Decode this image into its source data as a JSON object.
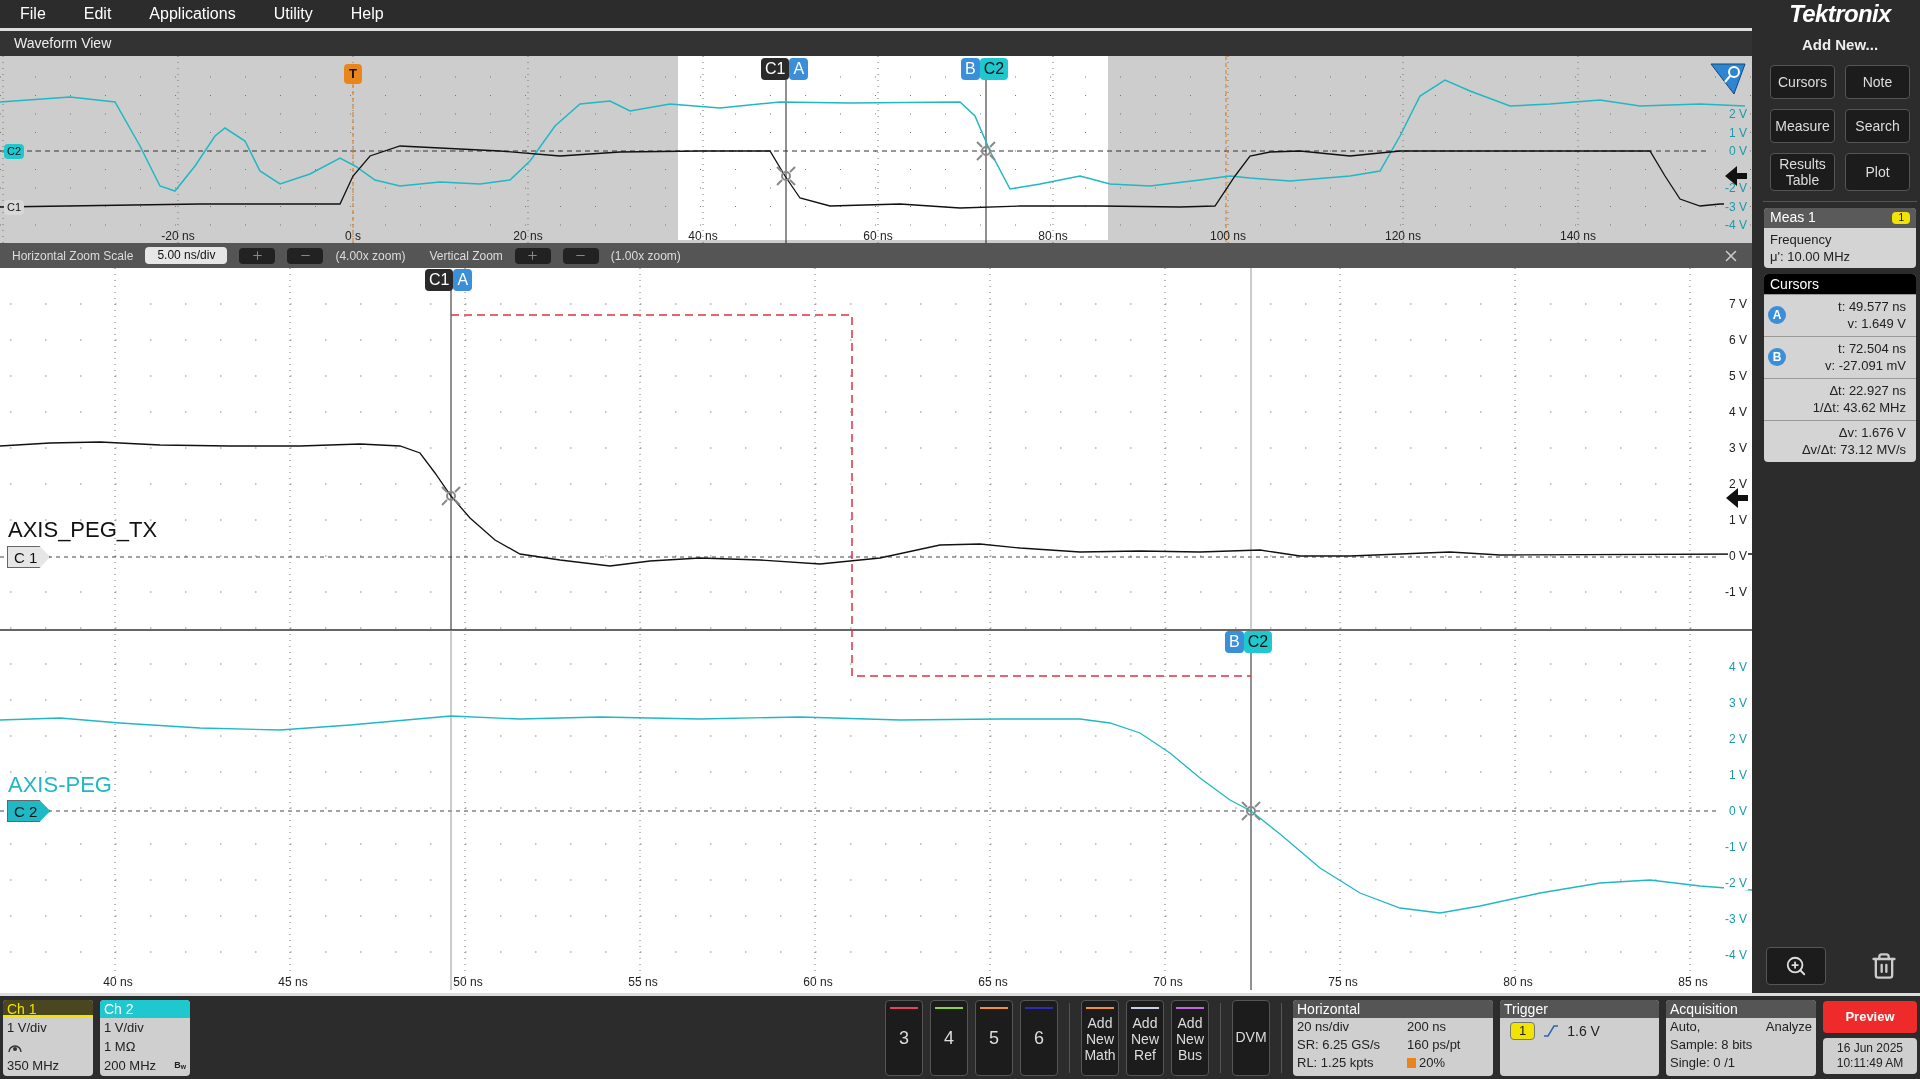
{
  "menu": [
    {
      "label": "File"
    },
    {
      "label": "Edit"
    },
    {
      "label": "Applications"
    },
    {
      "label": "Utility"
    },
    {
      "label": "Help"
    }
  ],
  "waveform_view": {
    "title": "Waveform View",
    "overview": {
      "x_ticks": [
        "-20 ns",
        "0 s",
        "20 ns",
        "40 ns",
        "60 ns",
        "80 ns",
        "100 ns",
        "120 ns",
        "140 ns"
      ],
      "y_ticks": [
        "2 V",
        "1 V",
        "0 V",
        "-2 V",
        "-3 V",
        "-4 V"
      ],
      "trigger_tag": "T",
      "channel_tags": [
        {
          "label": "C2",
          "color": "#1fc8cf"
        },
        {
          "label": "C1",
          "color": "#d8d8d8"
        }
      ],
      "cursor_a_tags": [
        "C1",
        "A"
      ],
      "cursor_b_tags": [
        "B",
        "C2"
      ]
    },
    "zoom_bar": {
      "horizontal_label": "Horizontal Zoom Scale",
      "horizontal_scale": "5.00 ns/div",
      "horizontal_zoom": "(4.00x zoom)",
      "vertical_label": "Vertical Zoom",
      "vertical_zoom": "(1.00x zoom)"
    },
    "main": {
      "x_ticks": [
        "40 ns",
        "45 ns",
        "50 ns",
        "55 ns",
        "60 ns",
        "65 ns",
        "70 ns",
        "75 ns",
        "80 ns",
        "85 ns"
      ],
      "upper_y_ticks": [
        "7 V",
        "6 V",
        "5 V",
        "4 V",
        "3 V",
        "2 V",
        "1 V",
        "0 V",
        "-1 V"
      ],
      "lower_y_ticks": [
        "4 V",
        "3 V",
        "2 V",
        "1 V",
        "0 V",
        "-1 V",
        "-2 V",
        "-3 V",
        "-4 V"
      ],
      "traces": [
        {
          "name": "AXIS_PEG_TX",
          "tag": "C 1",
          "color": "#111111"
        },
        {
          "name": "AXIS-PEG",
          "tag": "C 2",
          "color": "#1fb8c4"
        }
      ],
      "cursor_a_tags": [
        "C1",
        "A"
      ],
      "cursor_b_tags": [
        "B",
        "C2"
      ]
    }
  },
  "right_panel": {
    "logo": "Tektronix",
    "add_new": "Add New...",
    "buttons": [
      {
        "label": "Cursors"
      },
      {
        "label": "Note"
      },
      {
        "label": "Measure"
      },
      {
        "label": "Search"
      },
      {
        "label": "Results Table"
      },
      {
        "label": "Plot"
      }
    ],
    "measurement": {
      "title": "Meas 1",
      "source": "1",
      "name": "Frequency",
      "value": "μ': 10.00 MHz"
    },
    "cursors": {
      "title": "Cursors",
      "rows": [
        {
          "badge": "A",
          "lines": [
            "t: 49.577 ns",
            "v: 1.649 V"
          ]
        },
        {
          "badge": "B",
          "lines": [
            "t: 72.504 ns",
            "v: -27.091 mV"
          ]
        },
        {
          "lines": [
            "Δt: 22.927 ns",
            "1/Δt: 43.62 MHz"
          ]
        },
        {
          "lines": [
            "Δv: 1.676 V",
            "Δv/Δt: 73.12 MV/s"
          ]
        }
      ]
    }
  },
  "bottom_bar": {
    "channels": [
      {
        "label": "Ch 1",
        "selected": false,
        "color": "#f0e400",
        "lines": [
          {
            "kind": "text",
            "text": "1 V/div"
          },
          {
            "kind": "probe"
          },
          {
            "kind": "text",
            "text": "350 MHz"
          }
        ]
      },
      {
        "label": "Ch 2",
        "selected": true,
        "color": "#1fc8cf",
        "badge": "B$_{w}$",
        "lines": [
          {
            "kind": "text",
            "text": "1 V/div"
          },
          {
            "kind": "text",
            "text": "1 MΩ"
          },
          {
            "kind": "text",
            "text": "200 MHz"
          }
        ]
      }
    ],
    "extra_channels": [
      {
        "label": "3",
        "color": "#e04458"
      },
      {
        "label": "4",
        "color": "#8fd13a"
      },
      {
        "label": "5",
        "color": "#f0922a"
      },
      {
        "label": "6",
        "color": "#2c2cb8"
      }
    ],
    "add_buttons": [
      {
        "label": "Add New Math",
        "color": "#f0922a"
      },
      {
        "label": "Add New Ref",
        "color": "#c8cfe6"
      },
      {
        "label": "Add New Bus",
        "color": "#c266e0"
      }
    ],
    "dvm": "DVM",
    "horizontal": {
      "title": "Horizontal",
      "cells": [
        "20 ns/div",
        "200 ns",
        "SR: 6.25 GS/s",
        "160 ps/pt",
        "RL: 1.25 kpts",
        "20%"
      ]
    },
    "trigger": {
      "title": "Trigger",
      "source": "1",
      "level": "1.6 V"
    },
    "acquisition": {
      "title": "Acquisition",
      "mode": "Auto,",
      "state": "Analyze",
      "sample": "Sample: 8 bits",
      "count": "Single: 0 /1"
    },
    "preview": "Preview",
    "date": "16 Jun 2025",
    "time": "10:11:49 AM"
  }
}
